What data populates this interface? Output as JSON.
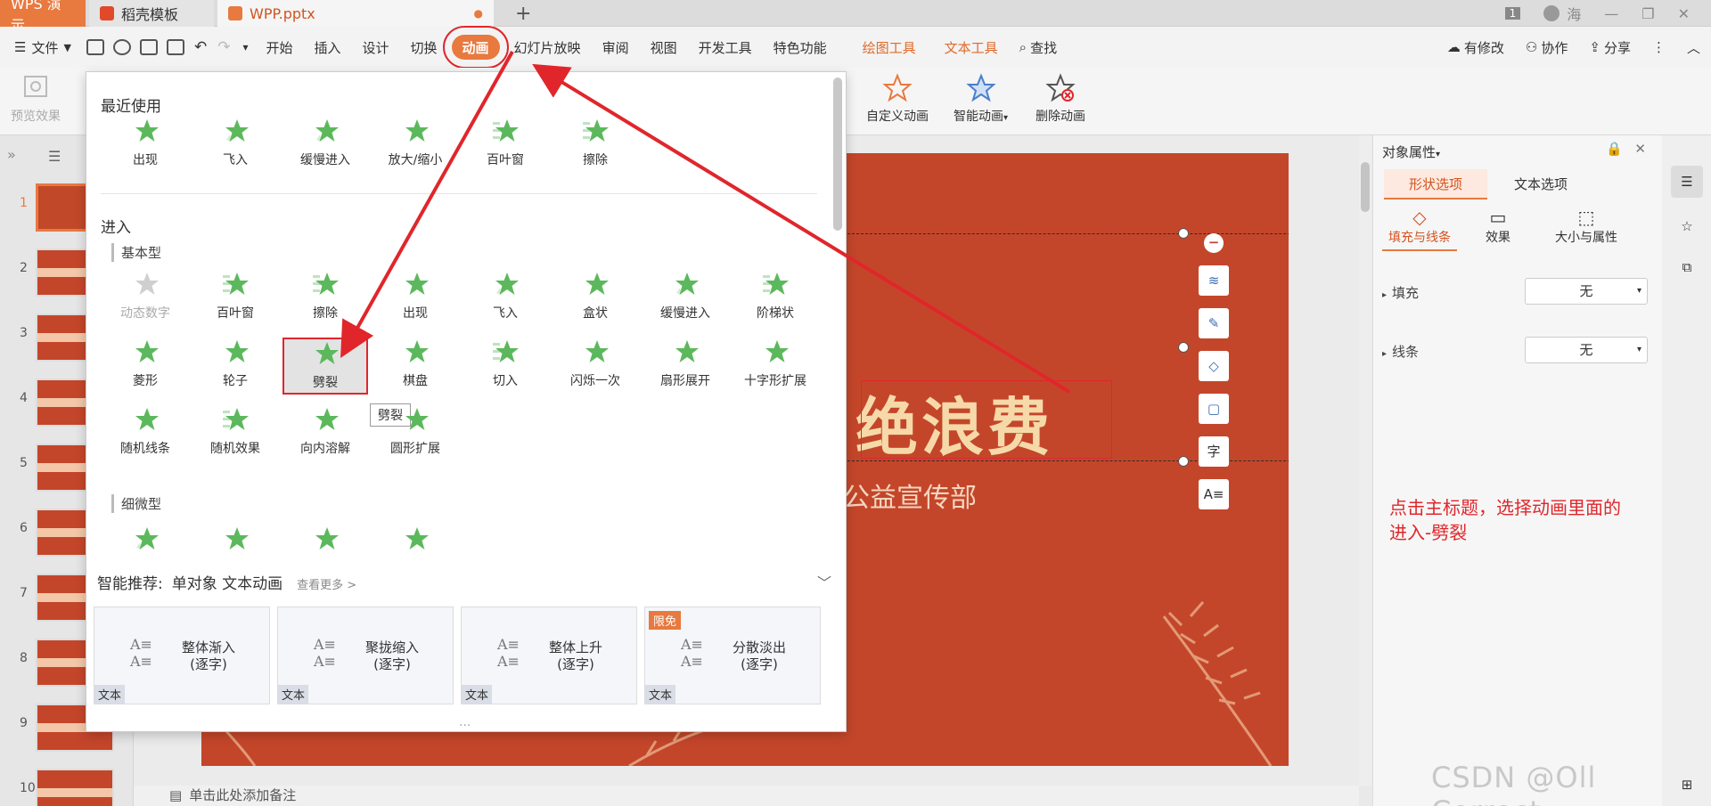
{
  "tabs": {
    "app": "WPS 演示",
    "template": "稻壳模板",
    "file": "WPP.pptx",
    "add": "+"
  },
  "window": {
    "page_badge": "1",
    "user": "海"
  },
  "menu": {
    "file": "文件",
    "start": "开始",
    "insert": "插入",
    "design": "设计",
    "switch": "切换",
    "animation": "动画",
    "slideshow": "幻灯片放映",
    "review": "审阅",
    "view": "视图",
    "devtools": "开发工具",
    "special": "特色功能",
    "drawtools": "绘图工具",
    "texttools": "文本工具",
    "search": "查找",
    "modified": "有修改",
    "collab": "协作",
    "share": "分享"
  },
  "ribbon": {
    "preview": "预览效果",
    "custom": "自定义动画",
    "smart": "智能动画",
    "delete": "删除动画"
  },
  "dropdown": {
    "recent_title": "最近使用",
    "recent": [
      "出现",
      "飞入",
      "缓慢进入",
      "放大/缩小",
      "百叶窗",
      "擦除"
    ],
    "enter_title": "进入",
    "basic_title": "基本型",
    "basic": [
      "动态数字",
      "百叶窗",
      "擦除",
      "出现",
      "飞入",
      "盒状",
      "缓慢进入",
      "阶梯状",
      "菱形",
      "轮子",
      "劈裂",
      "棋盘",
      "切入",
      "闪烁一次",
      "扇形展开",
      "十字形扩展",
      "随机线条",
      "随机效果",
      "向内溶解",
      "圆形扩展"
    ],
    "subtle_title": "细微型",
    "tooltip": "劈裂",
    "smart_title": "智能推荐:",
    "smart_sub": "单对象 文本动画",
    "see_more": "查看更多 >",
    "cards": [
      {
        "title": "整体渐入",
        "sub": "(逐字)",
        "tag": "文本",
        "badge": ""
      },
      {
        "title": "聚拢缩入",
        "sub": "(逐字)",
        "tag": "文本",
        "badge": ""
      },
      {
        "title": "整体上升",
        "sub": "(逐字)",
        "tag": "文本",
        "badge": ""
      },
      {
        "title": "分散淡出",
        "sub": "(逐字)",
        "tag": "文本",
        "badge": "限免"
      }
    ],
    "more_dots": "..."
  },
  "slide": {
    "title_partial": "绝浪费",
    "subtitle_partial": "公益宣传部"
  },
  "thumbs": [
    "1",
    "2",
    "3",
    "4",
    "5",
    "6",
    "7",
    "8",
    "9",
    "10"
  ],
  "notes": "单击此处添加备注",
  "panel": {
    "title": "对象属性",
    "tab_shape": "形状选项",
    "tab_text": "文本选项",
    "sub_fill": "填充与线条",
    "sub_effect": "效果",
    "sub_size": "大小与属性",
    "fill_label": "填充",
    "fill_value": "无",
    "line_label": "线条",
    "line_value": "无"
  },
  "annotation": {
    "line1": "点击主标题，选择动画里面的",
    "line2": "进入-劈裂"
  },
  "watermark": "CSDN @Oll Correct",
  "colors": {
    "accent": "#e8793f",
    "slide_bg": "#c4462a",
    "arrow": "#e0262b",
    "star": "#5cb85c"
  }
}
